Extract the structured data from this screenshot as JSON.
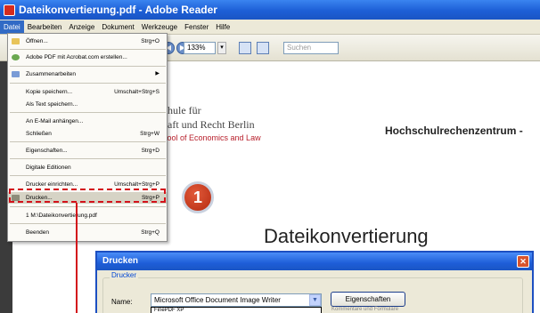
{
  "window": {
    "title": "Dateikonvertierung.pdf - Adobe Reader"
  },
  "menubar": {
    "items": [
      "Datei",
      "Bearbeiten",
      "Anzeige",
      "Dokument",
      "Werkzeuge",
      "Fenster",
      "Hilfe"
    ],
    "active": "Datei"
  },
  "toolbar": {
    "zoom": "133%",
    "search_placeholder": "Suchen"
  },
  "file_menu": {
    "items": [
      {
        "label": "Öffnen...",
        "shortcut": "Strg+O"
      },
      {
        "label": "Adobe PDF mit Acrobat.com erstellen...",
        "shortcut": ""
      },
      {
        "label": "Zusammenarbeiten",
        "shortcut": ""
      },
      {
        "label": "Kopie speichern...",
        "shortcut": "Umschalt+Strg+S"
      },
      {
        "label": "Als Text speichern...",
        "shortcut": ""
      },
      {
        "label": "An E-Mail anhängen...",
        "shortcut": ""
      },
      {
        "label": "Schließen",
        "shortcut": "Strg+W"
      },
      {
        "label": "Eigenschaften...",
        "shortcut": "Strg+D"
      },
      {
        "label": "Digitale Editionen",
        "shortcut": ""
      },
      {
        "label": "Drucker einrichten...",
        "shortcut": "Umschalt+Strg+P"
      },
      {
        "label": "Drucken...",
        "shortcut": "Strg+P"
      },
      {
        "label": "1 M:\\Dateikonvertierung.pdf",
        "shortcut": ""
      },
      {
        "label": "Beenden",
        "shortcut": "Strg+Q"
      }
    ]
  },
  "document": {
    "uni_line1": "hschule für",
    "uni_line2": "schaft und Recht Berlin",
    "uni_line3": "School of Economics and Law",
    "department": "Hochschulrechenzentrum",
    "dash": "-",
    "title": "Dateikonvertierung"
  },
  "step": {
    "number": "1"
  },
  "print_dialog": {
    "title": "Drucken",
    "group_label": "Drucker",
    "name_label": "Name:",
    "printer_selected": "Microsoft Office Document Image Writer",
    "dropdown_first_option": "FinePDF XP",
    "properties_button": "Eigenschaften",
    "faded_text": "Kommentare und Formulare"
  },
  "colors": {
    "highlight_red": "#d3121b",
    "xp_blue": "#1d5fd6",
    "menu_bg": "#ece9d8"
  }
}
